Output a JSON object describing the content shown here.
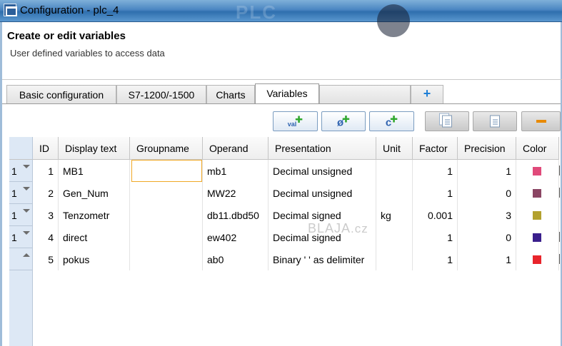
{
  "window": {
    "title": "Configuration - plc_4",
    "background_text": "PLC"
  },
  "header": {
    "title": "Create or edit variables",
    "subtitle": "User defined variables to access data"
  },
  "tabs": [
    {
      "label": "Basic configuration"
    },
    {
      "label": "S7-1200/-1500"
    },
    {
      "label": "Charts"
    },
    {
      "label": "Variables",
      "active": true
    },
    {
      "label": ""
    },
    {
      "label": "+"
    }
  ],
  "toolbar": {
    "buttons": [
      {
        "icon": "add-variable-icon",
        "label": "val"
      },
      {
        "icon": "add-operand-icon",
        "label": "ø"
      },
      {
        "icon": "add-constant-icon",
        "label": "c"
      },
      {
        "icon": "copy-icon",
        "disabled": true
      },
      {
        "icon": "paste-icon",
        "disabled": true
      },
      {
        "icon": "remove-icon",
        "disabled": true
      }
    ]
  },
  "grid": {
    "columns": [
      "ID",
      "Display text",
      "Groupname",
      "Operand",
      "Presentation",
      "Unit",
      "Factor",
      "Precision",
      "Color"
    ],
    "rows": [
      {
        "row_no": "1",
        "id": "1",
        "display": "MB1",
        "group": "",
        "operand": "mb1",
        "presentation": "Decimal unsigned",
        "unit": "",
        "factor": "1",
        "precision": "1",
        "color": "#e04a7a"
      },
      {
        "row_no": "1",
        "id": "2",
        "display": "Gen_Num",
        "group": "",
        "operand": "MW22",
        "presentation": "Decimal unsigned",
        "unit": "",
        "factor": "1",
        "precision": "0",
        "color": "#8b4664"
      },
      {
        "row_no": "1",
        "id": "3",
        "display": "Tenzometr",
        "group": "",
        "operand": "db11.dbd50",
        "presentation": "Decimal signed",
        "unit": "kg",
        "factor": "0.001",
        "precision": "3",
        "color": "#b3a12e"
      },
      {
        "row_no": "1",
        "id": "4",
        "display": "direct",
        "group": "",
        "operand": "ew402",
        "presentation": "Decimal signed",
        "unit": "",
        "factor": "1",
        "precision": "0",
        "color": "#3a1f8c"
      },
      {
        "row_no": "",
        "id": "5",
        "display": "pokus",
        "group": "",
        "operand": "ab0",
        "presentation": "Binary ' ' as delimiter",
        "unit": "",
        "factor": "1",
        "precision": "1",
        "color": "#e8242b"
      }
    ]
  },
  "watermark": {
    "text": "BLAJA",
    "suffix": ".cz"
  }
}
